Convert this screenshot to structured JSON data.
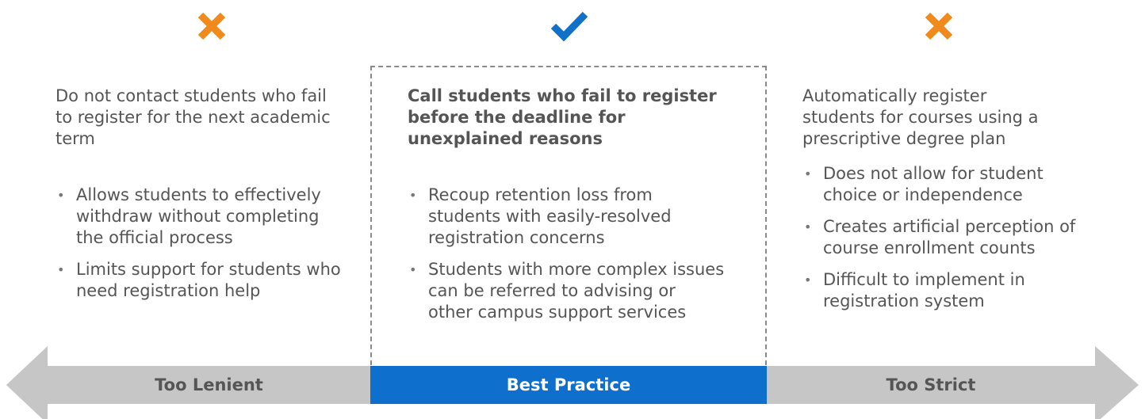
{
  "colors": {
    "cross": "#f18a1d",
    "check": "#1170c8",
    "bar_grey": "#c6c6c6",
    "bar_blue": "#0f6fcc",
    "text": "#555555",
    "dash": "#8a8a8a"
  },
  "columns": [
    {
      "icon": "cross-icon",
      "heading": "Do not contact students who fail to register for the next academic term",
      "bullets": [
        "Allows students to effectively withdraw without completing the official process",
        "Limits support for students who need registration help"
      ]
    },
    {
      "icon": "check-icon",
      "heading": "Call students who fail to register before the deadline for unexplained reasons",
      "bullets": [
        "Recoup retention loss from students with easily-resolved registration concerns",
        "Students with more complex issues can be referred to advising or other campus support services"
      ]
    },
    {
      "icon": "cross-icon",
      "heading": "Automatically register students for courses using a prescriptive degree plan",
      "bullets": [
        "Does not allow for student choice or independence",
        "Creates artificial perception of course enrollment counts",
        "Difficult to implement in registration system"
      ]
    }
  ],
  "scale": {
    "left_label": "Too Lenient",
    "middle_label": "Best Practice",
    "right_label": "Too Strict"
  }
}
